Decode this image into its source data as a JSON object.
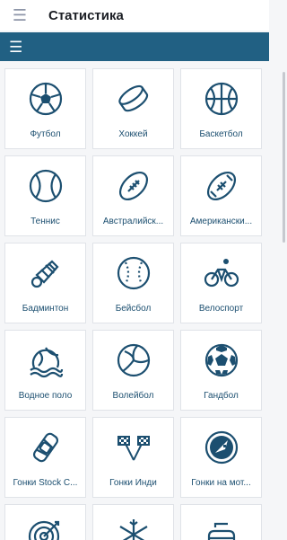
{
  "app_bar": {
    "title": "Статистика",
    "menu_icon": "hamburger-icon"
  },
  "section_bar": {
    "menu_icon": "hamburger-icon"
  },
  "colors": {
    "accent": "#216083",
    "icon": "#1c4f70",
    "background": "#f5f6f8"
  },
  "sports": [
    {
      "label": "Футбол",
      "icon": "soccer-ball-icon"
    },
    {
      "label": "Хоккей",
      "icon": "hockey-puck-icon"
    },
    {
      "label": "Баскетбол",
      "icon": "basketball-icon"
    },
    {
      "label": "Теннис",
      "icon": "tennis-ball-icon"
    },
    {
      "label": "Австралийск...",
      "icon": "australian-football-icon"
    },
    {
      "label": "Американски...",
      "icon": "american-football-icon"
    },
    {
      "label": "Бадминтон",
      "icon": "shuttlecock-icon"
    },
    {
      "label": "Бейсбол",
      "icon": "baseball-icon"
    },
    {
      "label": "Велоспорт",
      "icon": "cyclist-icon"
    },
    {
      "label": "Водное поло",
      "icon": "water-polo-icon"
    },
    {
      "label": "Волейбол",
      "icon": "volleyball-icon"
    },
    {
      "label": "Гандбол",
      "icon": "handball-icon"
    },
    {
      "label": "Гонки Stock C...",
      "icon": "stock-car-icon"
    },
    {
      "label": "Гонки Инди",
      "icon": "checkered-flags-icon"
    },
    {
      "label": "Гонки на мот...",
      "icon": "motorsport-badge-icon"
    }
  ],
  "partial_row_icons": [
    "darts-target-icon",
    "snowflake-icon",
    "curling-stone-icon"
  ]
}
